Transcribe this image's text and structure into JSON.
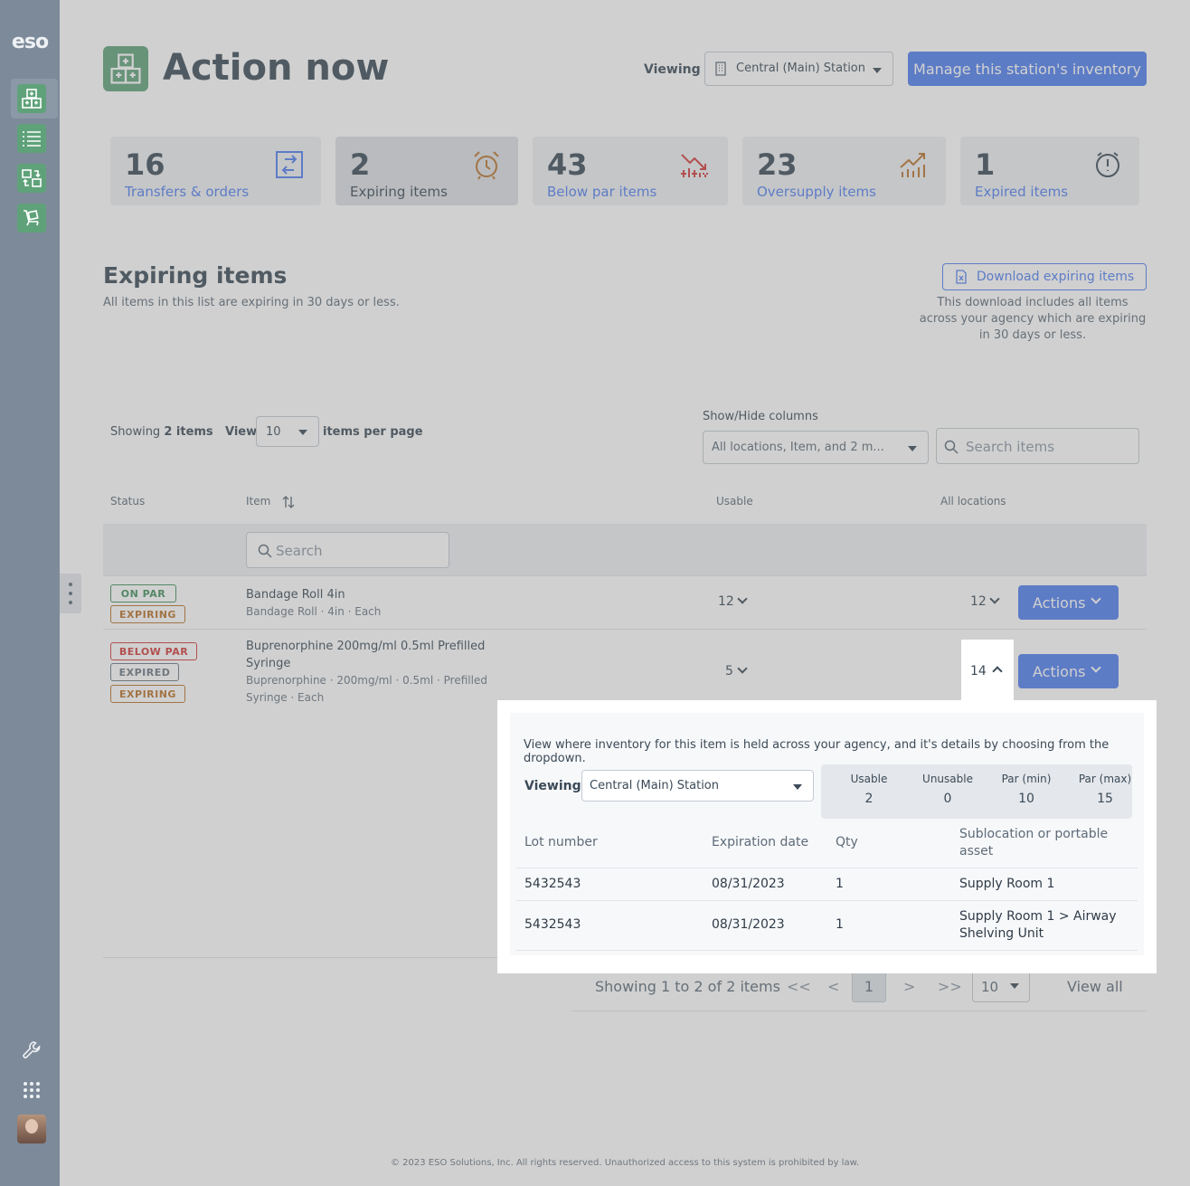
{
  "sidebar": {
    "logo": "eso",
    "nav": [
      "inventory-grid-icon",
      "list-icon",
      "transfer-icon",
      "cart-icon"
    ],
    "tools": [
      "wrench-icon",
      "apps-grid-icon"
    ]
  },
  "header": {
    "title": "Action now",
    "viewing_label": "Viewing",
    "station": "Central (Main) Station",
    "manage_button": "Manage this station's inventory"
  },
  "cards": [
    {
      "count": "16",
      "label": "Transfers & orders",
      "icon": "transfer-icon",
      "color": "#4f7ff0"
    },
    {
      "count": "2",
      "label": "Expiring items",
      "icon": "alarm-clock-icon",
      "color": "#b9722a"
    },
    {
      "count": "43",
      "label": "Below par items",
      "icon": "trend-down-icon",
      "color": "#d23a3a"
    },
    {
      "count": "23",
      "label": "Oversupply items",
      "icon": "trend-up-icon",
      "color": "#b9722a"
    },
    {
      "count": "1",
      "label": "Expired items",
      "icon": "stopwatch-icon",
      "color": "#3b4a57"
    }
  ],
  "section": {
    "title": "Expiring items",
    "subtitle": "All items in this list are expiring in 30 days or less.",
    "download_button": "Download expiring items",
    "download_note": "This download includes all items across your agency which are expiring in 30 days or less."
  },
  "controls": {
    "showing_prefix": "Showing",
    "showing_count": "2 items",
    "view_label": "View",
    "per_page": "10",
    "per_page_suffix": "items per page",
    "showhide_label": "Show/Hide columns",
    "columns_value": "All locations, Item, and 2 m...",
    "search_placeholder": "Search items"
  },
  "table": {
    "headers": {
      "status": "Status",
      "item": "Item",
      "usable": "Usable",
      "all_locations": "All locations"
    },
    "item_search_placeholder": "Search",
    "rows": [
      {
        "badges": [
          "ON PAR",
          "EXPIRING"
        ],
        "name": "Bandage Roll 4in",
        "sub": "Bandage Roll · 4in · Each",
        "usable": "12",
        "all_locations": "12",
        "action": "Actions"
      },
      {
        "badges": [
          "BELOW PAR",
          "EXPIRED",
          "EXPIRING"
        ],
        "name_line1": "Buprenorphine 200mg/ml 0.5ml Prefilled",
        "name_line2": "Syringe",
        "sub_line1": "Buprenorphine · 200mg/ml · 0.5ml · Prefilled",
        "sub_line2": "Syringe · Each",
        "usable": "5",
        "all_locations": "14",
        "action": "Actions"
      }
    ]
  },
  "pagination": {
    "summary": "Showing 1 to 2 of 2 items",
    "first": "<<",
    "prev": "<",
    "page": "1",
    "next": ">",
    "last": ">>",
    "per_page": "10",
    "view_all": "View all"
  },
  "popover": {
    "description": "View where inventory for this item is held across your agency, and it's details by choosing from the dropdown.",
    "viewing_label": "Viewing",
    "station": "Central (Main) Station",
    "stats": [
      {
        "label": "Usable",
        "value": "2"
      },
      {
        "label": "Unusable",
        "value": "0"
      },
      {
        "label": "Par (min)",
        "value": "10"
      },
      {
        "label": "Par (max)",
        "value": "15"
      }
    ],
    "headers": {
      "lot": "Lot number",
      "exp": "Expiration date",
      "qty": "Qty",
      "subloc_1": "Sublocation or portable",
      "subloc_2": "asset"
    },
    "rows": [
      {
        "lot": "5432543",
        "exp": "08/31/2023",
        "qty": "1",
        "subloc_1": "Supply Room 1",
        "subloc_2": ""
      },
      {
        "lot": "5432543",
        "exp": "08/31/2023",
        "qty": "1",
        "subloc_1": "Supply Room 1 > Airway",
        "subloc_2": "Shelving Unit"
      }
    ]
  },
  "footer": "© 2023 ESO Solutions, Inc. All rights reserved. Unauthorized access to this system is prohibited by law."
}
